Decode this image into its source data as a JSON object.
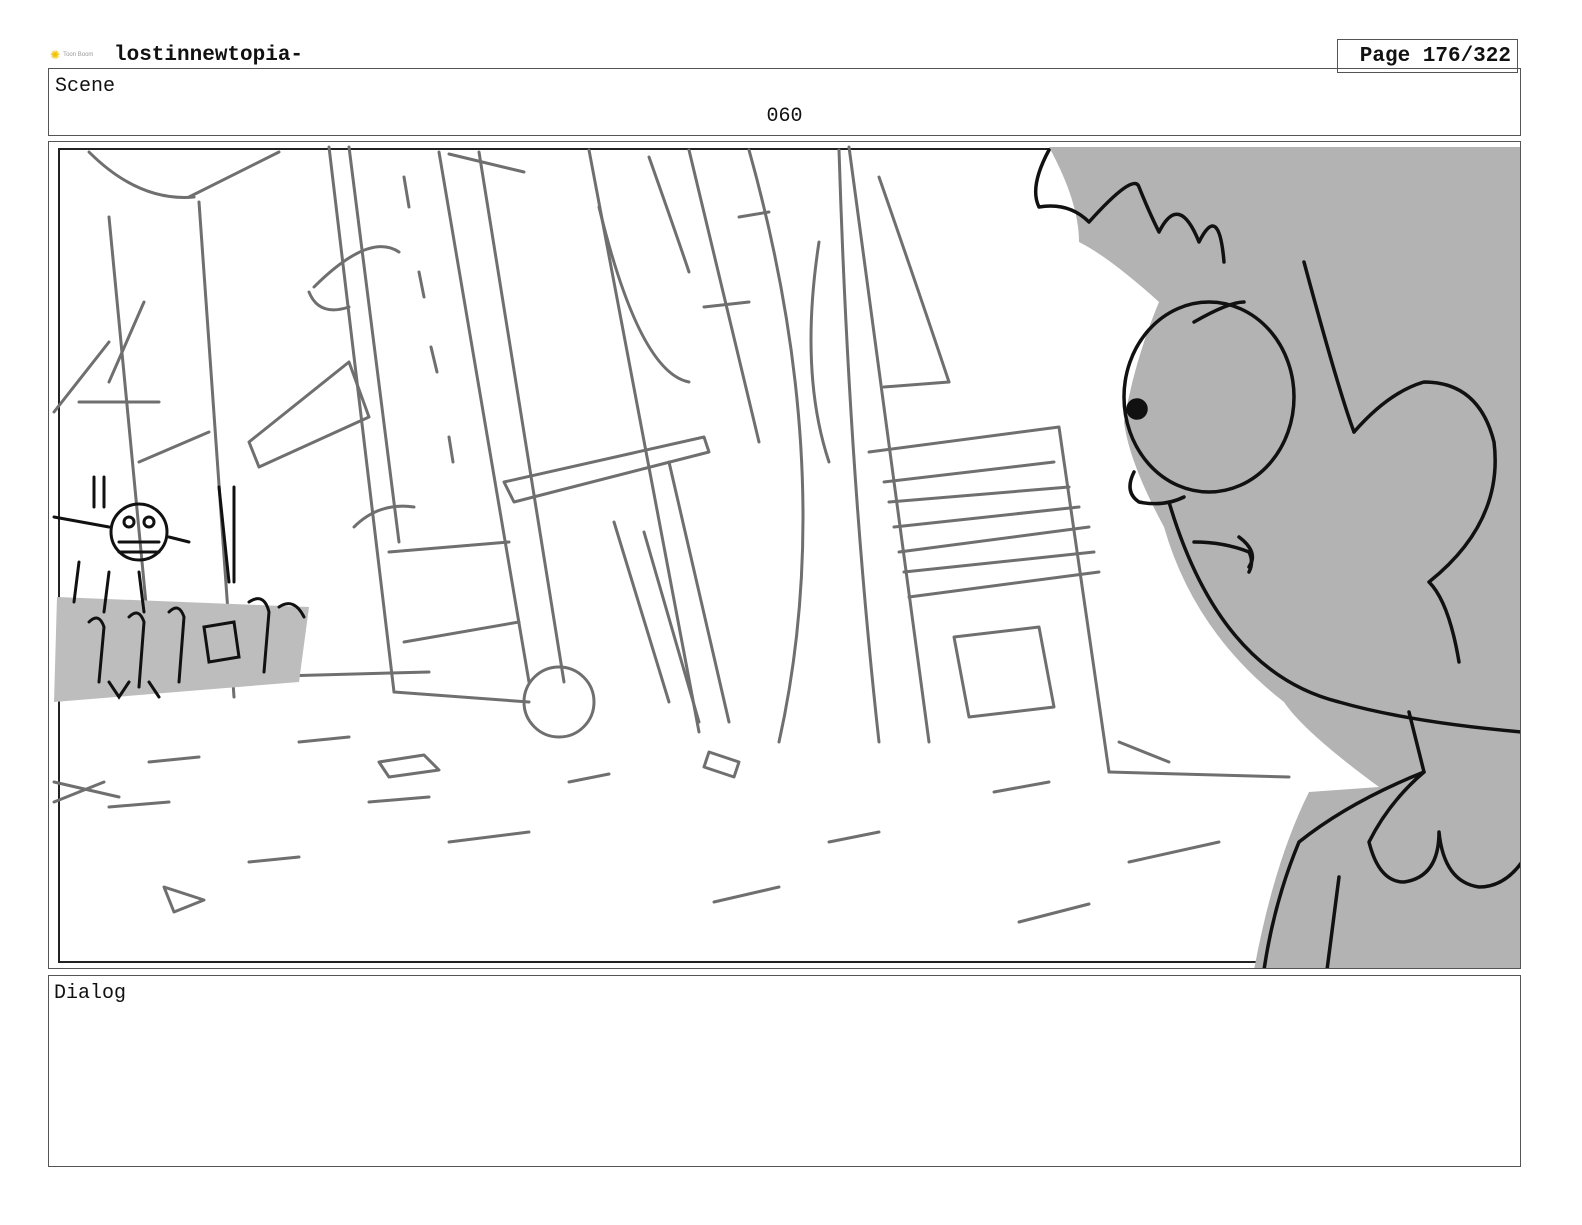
{
  "header": {
    "logo_text": "Toon Boom",
    "project_title": "lostinnewtopia-",
    "page_label": "Page 176/322"
  },
  "scene": {
    "label": "Scene",
    "number": "060"
  },
  "dialog": {
    "label": "Dialog",
    "text": ""
  },
  "colors": {
    "character_fill": "#b3b3b3",
    "sketch_line": "#6f6f6f",
    "ink_line": "#111111",
    "border": "#555555"
  }
}
